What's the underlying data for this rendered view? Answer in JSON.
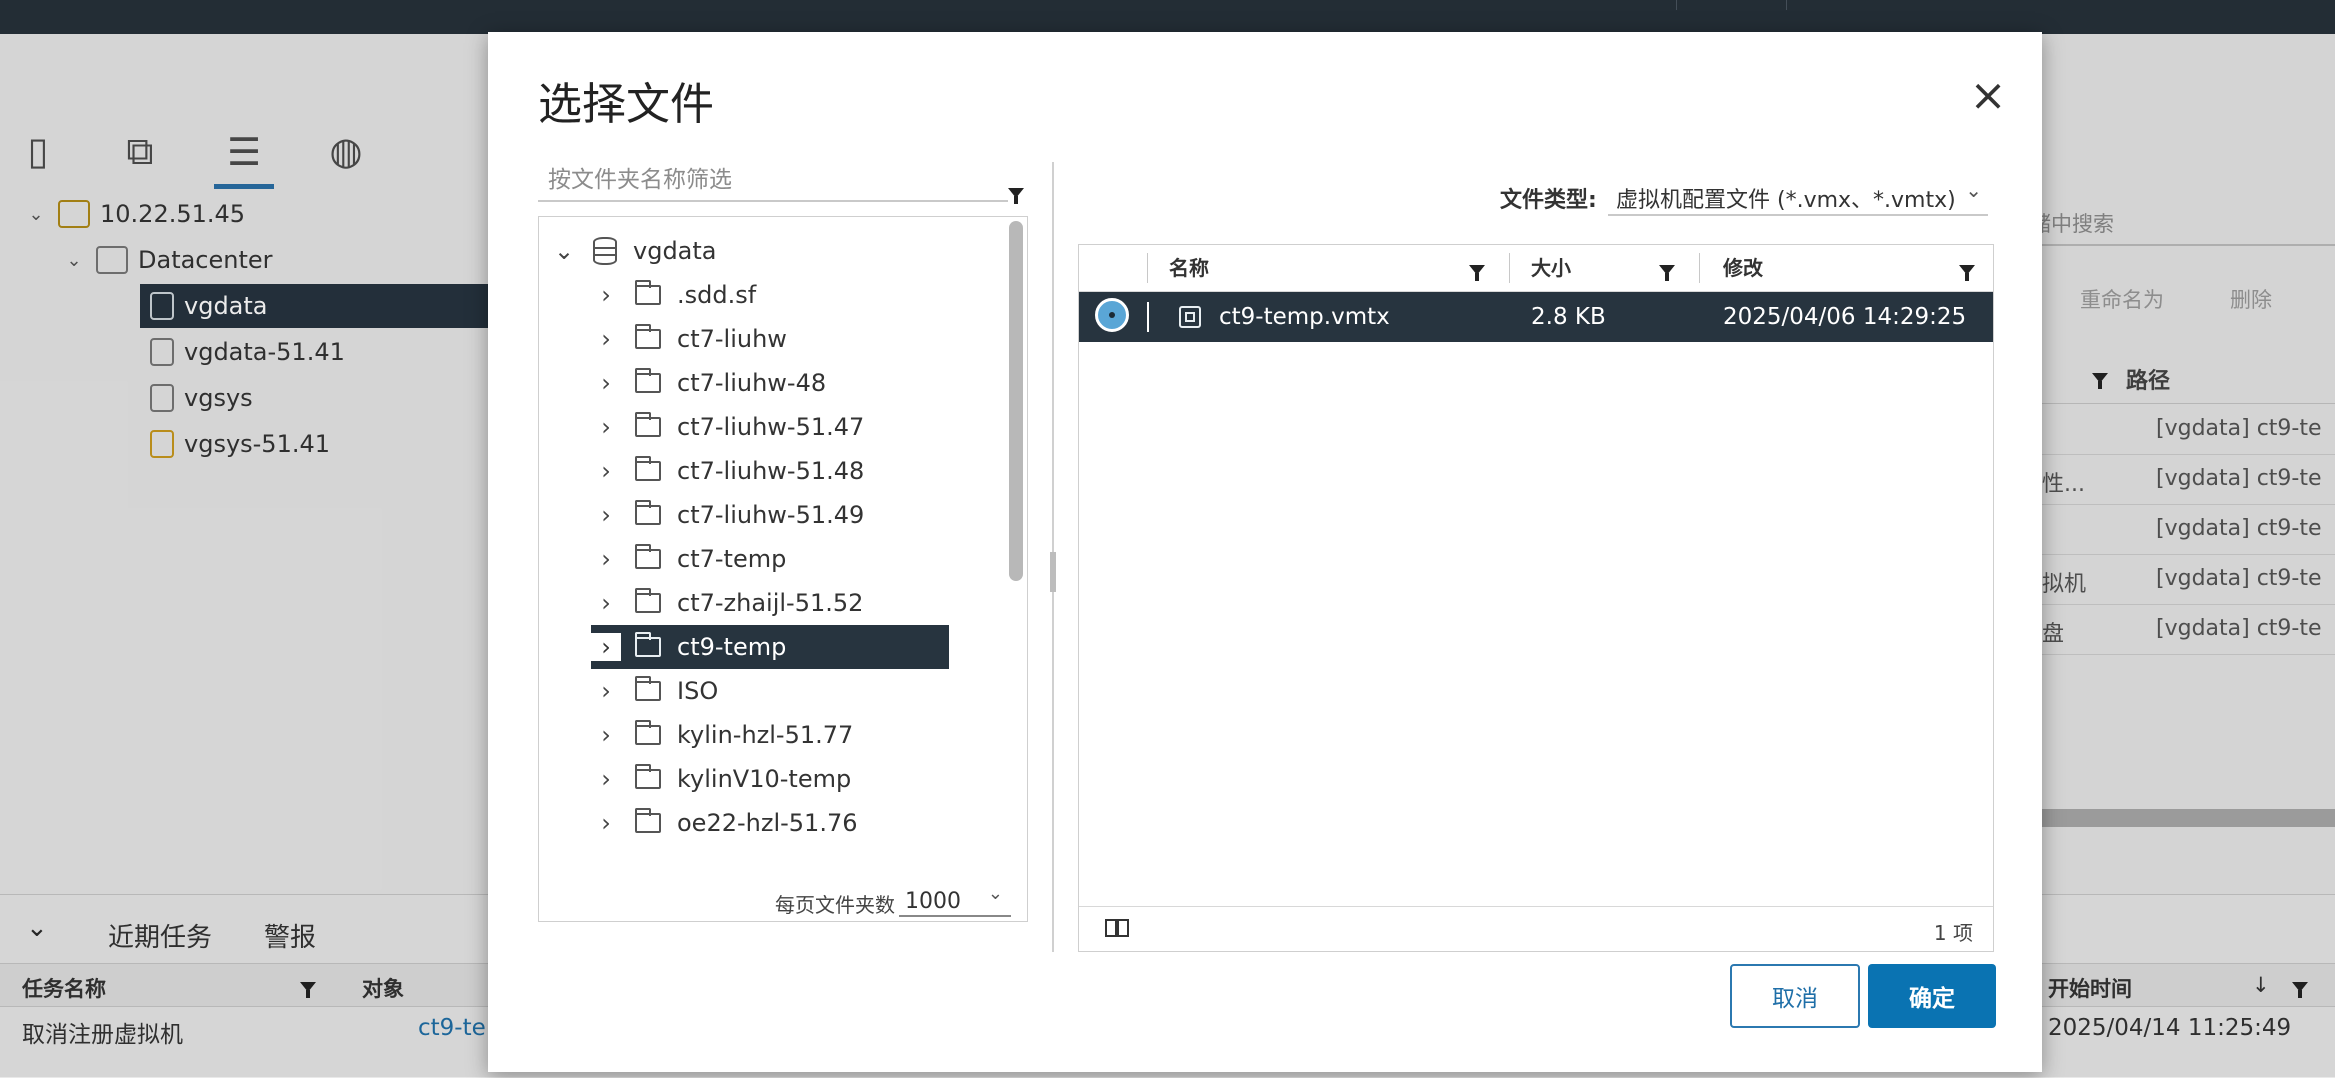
{
  "background": {
    "tree": [
      {
        "label": "10.22.51.45"
      },
      {
        "label": "Datacenter"
      },
      {
        "label": "vgdata"
      },
      {
        "label": "vgdata-51.41"
      },
      {
        "label": "vgsys"
      },
      {
        "label": "vgsys-51.41"
      }
    ],
    "right_panel": {
      "search_text": "储中搜索",
      "rename": "重命名为",
      "delete": "删除",
      "path_header": "路径",
      "rows": [
        {
          "a": "",
          "b": "[vgdata] ct9-te"
        },
        {
          "a": "失性...",
          "b": "[vgdata] ct9-te"
        },
        {
          "a": "",
          "b": "[vgdata] ct9-te"
        },
        {
          "a": "虚拟机",
          "b": "[vgdata] ct9-te"
        },
        {
          "a": "磁盘",
          "b": "[vgdata] ct9-te"
        }
      ]
    },
    "bottom": {
      "tab_recent": "近期任务",
      "tab_alarms": "警报",
      "col_task": "任务名称",
      "col_object": "对象",
      "col_start": "开始时间",
      "row_task": "取消注册虚拟机",
      "row_object": "ct9-te",
      "row_start": "2025/04/14 11:25:49"
    }
  },
  "dialog": {
    "title": "选择文件",
    "filter_placeholder": "按文件夹名称筛选",
    "tree_root": "vgdata",
    "folders": [
      ".sdd.sf",
      "ct7-liuhw",
      "ct7-liuhw-48",
      "ct7-liuhw-51.47",
      "ct7-liuhw-51.48",
      "ct7-liuhw-51.49",
      "ct7-temp",
      "ct7-zhaijl-51.52",
      "ct9-temp",
      "ISO",
      "kylin-hzl-51.77",
      "kylinV10-temp",
      "oe22-hzl-51.76"
    ],
    "selected_folder": "ct9-temp",
    "per_page_label": "每页文件夹数",
    "per_page_value": "1000",
    "file_type_label": "文件类型:",
    "file_type_value": "虚拟机配置文件 (*.vmx、*.vmtx)",
    "columns": {
      "name": "名称",
      "size": "大小",
      "modified": "修改"
    },
    "files": [
      {
        "name": "ct9-temp.vmtx",
        "size": "2.8 KB",
        "modified": "2025/04/06 14:29:25"
      }
    ],
    "item_count": "1 项",
    "cancel": "取消",
    "ok": "确定"
  }
}
